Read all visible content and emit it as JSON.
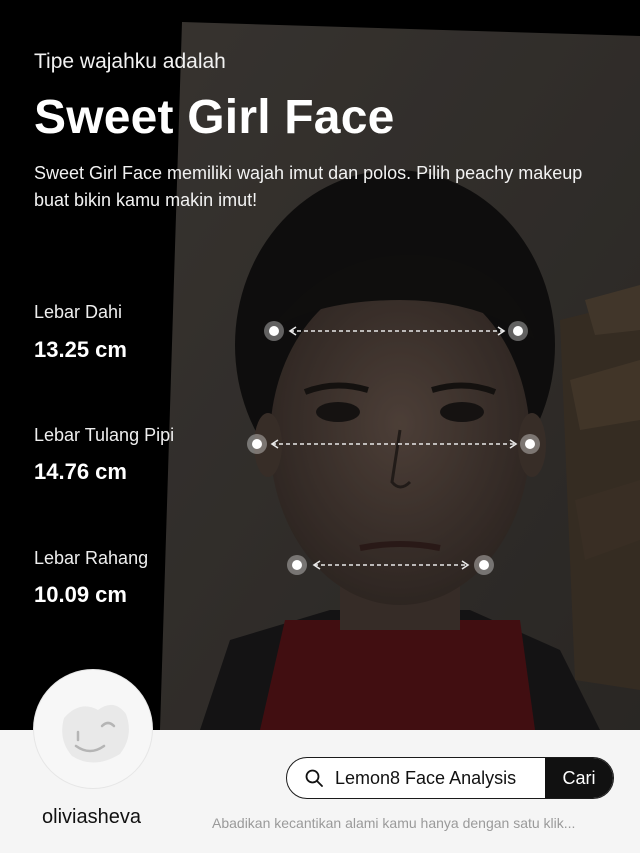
{
  "header": {
    "subtitle": "Tipe wajahku adalah",
    "title": "Sweet Girl Face",
    "description": "Sweet Girl Face memiliki wajah imut dan polos. Pilih peachy makeup buat bikin kamu makin imut!"
  },
  "metrics": [
    {
      "label": "Lebar Dahi",
      "value": "13.25 cm"
    },
    {
      "label": "Lebar Tulang Pipi",
      "value": "14.76 cm"
    },
    {
      "label": "Lebar Rahang",
      "value": "10.09 cm"
    }
  ],
  "profile": {
    "username": "oliviasheva"
  },
  "search": {
    "query": "Lemon8 Face Analysis",
    "button_label": "Cari"
  },
  "footer": {
    "tagline": "Abadikan kecantikan alami kamu hanya dengan satu klik..."
  }
}
